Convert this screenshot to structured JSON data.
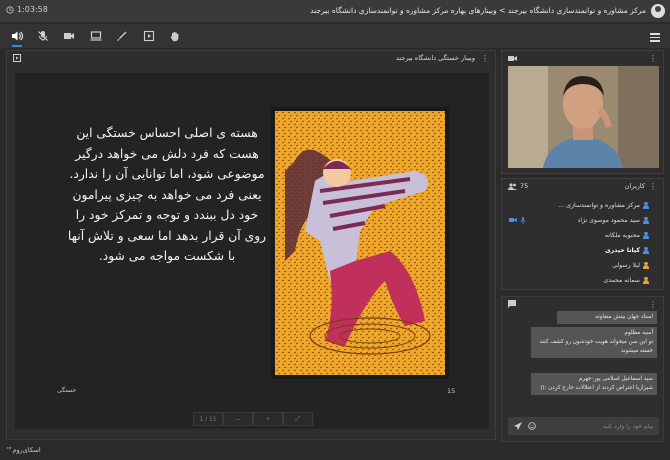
{
  "header": {
    "timer": "1:03:58",
    "breadcrumb": "مرکز مشاوره و توانمندسازی دانشگاه بیرجند > وبینارهای بهاره مرکز مشاوره و توانمندسازی دانشگاه بیرجند"
  },
  "toolbar": {
    "tools": [
      "speaker-icon",
      "mic-off-icon",
      "camera-icon",
      "screen-share-icon",
      "draw-icon",
      "media-icon",
      "raise-hand-icon"
    ]
  },
  "presentation": {
    "title": "وبینار خستگی دانشگاه بیرجند",
    "slide_text": "هسته ی اصلی احساس خستگی این هست که فرد دلش می خواهد درگیر موضوعی شود، اما توانایی آن را ندارد. یعنی فرد می خواهد به چیزی پیرامون خود دل ببندد و توجه و تمرکز خود را روی آن قرار بدهد اما سعی و تلاش آنها با شکست مواجه می شود.",
    "slide_footer_left": "خستگی",
    "slide_number": "15",
    "controls": [
      "1 / 15",
      "−",
      "+",
      "⤢"
    ]
  },
  "users": {
    "title": "کاربران",
    "count": "75",
    "list": [
      {
        "name": "مرکز مشاوره و توانمندسازی ...",
        "bold": false,
        "color": "blue"
      },
      {
        "name": "سید محمود موسوی نژاد",
        "bold": false,
        "color": "blue"
      },
      {
        "name": "محبوبه ملکانه",
        "bold": false,
        "color": "blue"
      },
      {
        "name": "کیانا حیدری",
        "bold": true,
        "color": "blue"
      },
      {
        "name": "لیلا رسولی",
        "bold": false,
        "color": "orange"
      },
      {
        "name": "سمانه محمدی",
        "bold": false,
        "color": "orange"
      }
    ]
  },
  "chat": {
    "messages": [
      "استاد جهان بینش متفاوته",
      "آسیه مظلوم\nتو این سن میخواند هویت خودشون رو کشف کنند خسته میشوند",
      "سید اسماعیل اسلامی پور-جهرم\nشیرازیا اعتراض کردند از اعتلالات خارج کردن :(("
    ],
    "input_placeholder": "پیام خود را وارد کنید"
  },
  "footer": {
    "brand": "اسکای‌روم™"
  }
}
